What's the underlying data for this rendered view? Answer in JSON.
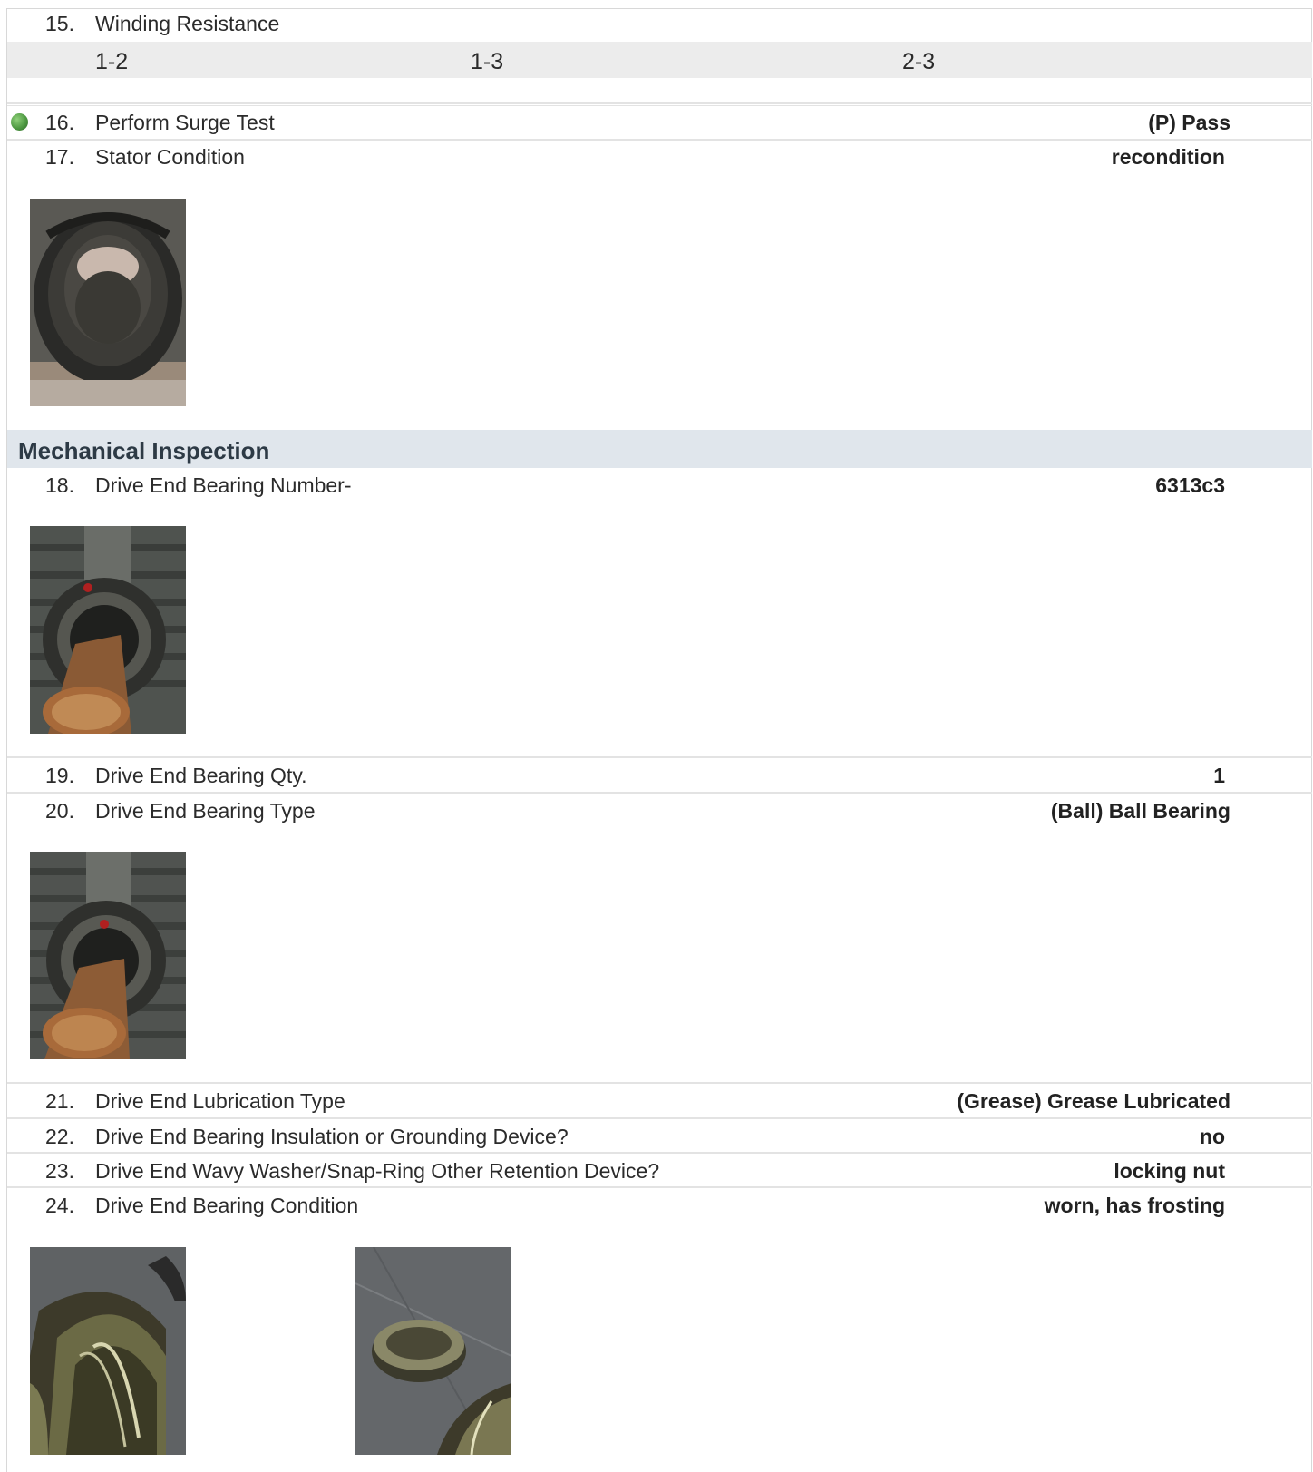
{
  "items": {
    "i15": {
      "num": "15.",
      "label": "Winding Resistance",
      "cols": [
        "1-2",
        "1-3",
        "2-3"
      ]
    },
    "i16": {
      "num": "16.",
      "label": "Perform Surge Test",
      "value": "(P) Pass",
      "status_color": "#4f9a43"
    },
    "i17": {
      "num": "17.",
      "label": "Stator Condition",
      "value": "recondition"
    },
    "section": {
      "title": "Mechanical Inspection"
    },
    "i18": {
      "num": "18.",
      "label": "Drive End Bearing Number-",
      "value": "6313c3"
    },
    "i19": {
      "num": "19.",
      "label": "Drive End Bearing Qty.",
      "value": "1"
    },
    "i20": {
      "num": "20.",
      "label": "Drive End Bearing Type",
      "value": "(Ball) Ball Bearing"
    },
    "i21": {
      "num": "21.",
      "label": "Drive End Lubrication Type",
      "value": "(Grease) Grease Lubricated"
    },
    "i22": {
      "num": "22.",
      "label": "Drive End Bearing Insulation or Grounding Device?",
      "value": "no"
    },
    "i23": {
      "num": "23.",
      "label": "Drive End Wavy Washer/Snap-Ring Other Retention Device?",
      "value": "locking nut"
    },
    "i24": {
      "num": "24.",
      "label": "Drive End Bearing Condition",
      "value": "worn, has frosting"
    }
  }
}
